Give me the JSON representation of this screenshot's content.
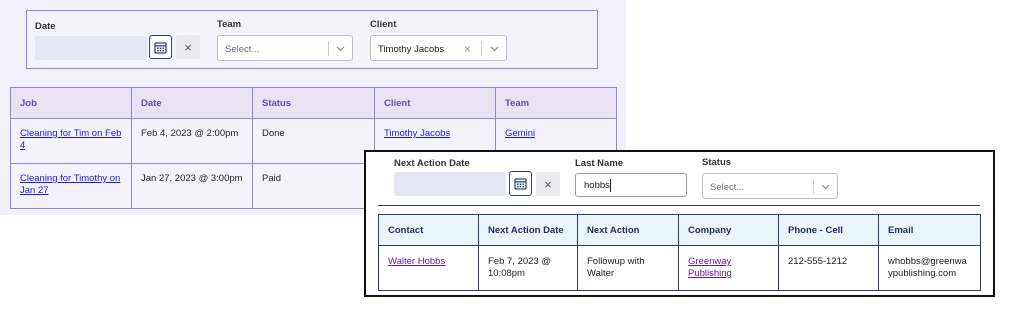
{
  "back": {
    "filters": {
      "date_label": "Date",
      "team_label": "Team",
      "team_placeholder": "Select...",
      "client_label": "Client",
      "client_value": "Timothy Jacobs"
    },
    "table": {
      "headers": [
        "Job",
        "Date",
        "Status",
        "Client",
        "Team"
      ],
      "rows": [
        {
          "job": "Cleaning for Tim on Feb 4",
          "date": "Feb 4, 2023 @ 2:00pm",
          "status": "Done",
          "client": "Timothy Jacobs",
          "team": "Gemini"
        },
        {
          "job": "Cleaning for Timothy on Jan 27",
          "date": "Jan 27, 2023 @ 3:00pm",
          "status": "Paid",
          "client": "",
          "team": ""
        }
      ]
    }
  },
  "front": {
    "filters": {
      "next_action_date_label": "Next Action Date",
      "last_name_label": "Last Name",
      "last_name_value": "hobbs",
      "status_label": "Status",
      "status_placeholder": "Select..."
    },
    "table": {
      "headers": [
        "Contact",
        "Next Action Date",
        "Next Action",
        "Company",
        "Phone - Cell",
        "Email"
      ],
      "rows": [
        {
          "contact": "Walter Hobbs",
          "next_action_date": "Feb 7, 2023 @ 10:08pm",
          "next_action": "Followup with Walter",
          "company": "Greenway Publishing",
          "phone": "212-555-1212",
          "email": "whobbs@greenwaypublishing.com"
        }
      ]
    }
  }
}
